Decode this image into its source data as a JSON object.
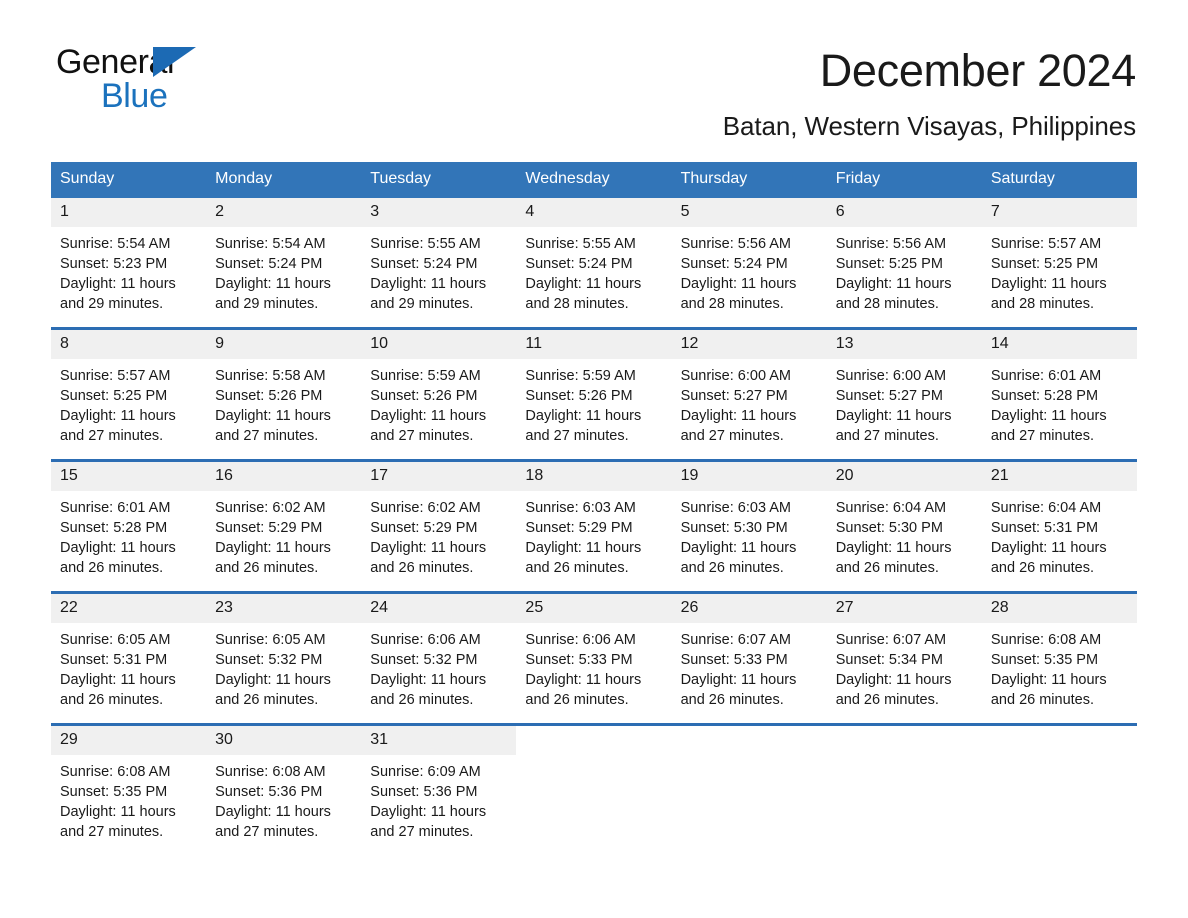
{
  "brand": {
    "name_part1": "General",
    "name_part2": "Blue",
    "logo_icon": "triangle-logo-icon",
    "accent_color": "#1b72bd"
  },
  "header": {
    "month_title": "December 2024",
    "location": "Batan, Western Visayas, Philippines"
  },
  "calendar": {
    "header_bg": "#3275b8",
    "row_divider_color": "#2c6db3",
    "day_number_bg": "#f0f0f0",
    "weekdays": [
      "Sunday",
      "Monday",
      "Tuesday",
      "Wednesday",
      "Thursday",
      "Friday",
      "Saturday"
    ],
    "weeks": [
      [
        {
          "day": "1",
          "sunrise": "Sunrise: 5:54 AM",
          "sunset": "Sunset: 5:23 PM",
          "daylight_line1": "Daylight: 11 hours",
          "daylight_line2": "and 29 minutes."
        },
        {
          "day": "2",
          "sunrise": "Sunrise: 5:54 AM",
          "sunset": "Sunset: 5:24 PM",
          "daylight_line1": "Daylight: 11 hours",
          "daylight_line2": "and 29 minutes."
        },
        {
          "day": "3",
          "sunrise": "Sunrise: 5:55 AM",
          "sunset": "Sunset: 5:24 PM",
          "daylight_line1": "Daylight: 11 hours",
          "daylight_line2": "and 29 minutes."
        },
        {
          "day": "4",
          "sunrise": "Sunrise: 5:55 AM",
          "sunset": "Sunset: 5:24 PM",
          "daylight_line1": "Daylight: 11 hours",
          "daylight_line2": "and 28 minutes."
        },
        {
          "day": "5",
          "sunrise": "Sunrise: 5:56 AM",
          "sunset": "Sunset: 5:24 PM",
          "daylight_line1": "Daylight: 11 hours",
          "daylight_line2": "and 28 minutes."
        },
        {
          "day": "6",
          "sunrise": "Sunrise: 5:56 AM",
          "sunset": "Sunset: 5:25 PM",
          "daylight_line1": "Daylight: 11 hours",
          "daylight_line2": "and 28 minutes."
        },
        {
          "day": "7",
          "sunrise": "Sunrise: 5:57 AM",
          "sunset": "Sunset: 5:25 PM",
          "daylight_line1": "Daylight: 11 hours",
          "daylight_line2": "and 28 minutes."
        }
      ],
      [
        {
          "day": "8",
          "sunrise": "Sunrise: 5:57 AM",
          "sunset": "Sunset: 5:25 PM",
          "daylight_line1": "Daylight: 11 hours",
          "daylight_line2": "and 27 minutes."
        },
        {
          "day": "9",
          "sunrise": "Sunrise: 5:58 AM",
          "sunset": "Sunset: 5:26 PM",
          "daylight_line1": "Daylight: 11 hours",
          "daylight_line2": "and 27 minutes."
        },
        {
          "day": "10",
          "sunrise": "Sunrise: 5:59 AM",
          "sunset": "Sunset: 5:26 PM",
          "daylight_line1": "Daylight: 11 hours",
          "daylight_line2": "and 27 minutes."
        },
        {
          "day": "11",
          "sunrise": "Sunrise: 5:59 AM",
          "sunset": "Sunset: 5:26 PM",
          "daylight_line1": "Daylight: 11 hours",
          "daylight_line2": "and 27 minutes."
        },
        {
          "day": "12",
          "sunrise": "Sunrise: 6:00 AM",
          "sunset": "Sunset: 5:27 PM",
          "daylight_line1": "Daylight: 11 hours",
          "daylight_line2": "and 27 minutes."
        },
        {
          "day": "13",
          "sunrise": "Sunrise: 6:00 AM",
          "sunset": "Sunset: 5:27 PM",
          "daylight_line1": "Daylight: 11 hours",
          "daylight_line2": "and 27 minutes."
        },
        {
          "day": "14",
          "sunrise": "Sunrise: 6:01 AM",
          "sunset": "Sunset: 5:28 PM",
          "daylight_line1": "Daylight: 11 hours",
          "daylight_line2": "and 27 minutes."
        }
      ],
      [
        {
          "day": "15",
          "sunrise": "Sunrise: 6:01 AM",
          "sunset": "Sunset: 5:28 PM",
          "daylight_line1": "Daylight: 11 hours",
          "daylight_line2": "and 26 minutes."
        },
        {
          "day": "16",
          "sunrise": "Sunrise: 6:02 AM",
          "sunset": "Sunset: 5:29 PM",
          "daylight_line1": "Daylight: 11 hours",
          "daylight_line2": "and 26 minutes."
        },
        {
          "day": "17",
          "sunrise": "Sunrise: 6:02 AM",
          "sunset": "Sunset: 5:29 PM",
          "daylight_line1": "Daylight: 11 hours",
          "daylight_line2": "and 26 minutes."
        },
        {
          "day": "18",
          "sunrise": "Sunrise: 6:03 AM",
          "sunset": "Sunset: 5:29 PM",
          "daylight_line1": "Daylight: 11 hours",
          "daylight_line2": "and 26 minutes."
        },
        {
          "day": "19",
          "sunrise": "Sunrise: 6:03 AM",
          "sunset": "Sunset: 5:30 PM",
          "daylight_line1": "Daylight: 11 hours",
          "daylight_line2": "and 26 minutes."
        },
        {
          "day": "20",
          "sunrise": "Sunrise: 6:04 AM",
          "sunset": "Sunset: 5:30 PM",
          "daylight_line1": "Daylight: 11 hours",
          "daylight_line2": "and 26 minutes."
        },
        {
          "day": "21",
          "sunrise": "Sunrise: 6:04 AM",
          "sunset": "Sunset: 5:31 PM",
          "daylight_line1": "Daylight: 11 hours",
          "daylight_line2": "and 26 minutes."
        }
      ],
      [
        {
          "day": "22",
          "sunrise": "Sunrise: 6:05 AM",
          "sunset": "Sunset: 5:31 PM",
          "daylight_line1": "Daylight: 11 hours",
          "daylight_line2": "and 26 minutes."
        },
        {
          "day": "23",
          "sunrise": "Sunrise: 6:05 AM",
          "sunset": "Sunset: 5:32 PM",
          "daylight_line1": "Daylight: 11 hours",
          "daylight_line2": "and 26 minutes."
        },
        {
          "day": "24",
          "sunrise": "Sunrise: 6:06 AM",
          "sunset": "Sunset: 5:32 PM",
          "daylight_line1": "Daylight: 11 hours",
          "daylight_line2": "and 26 minutes."
        },
        {
          "day": "25",
          "sunrise": "Sunrise: 6:06 AM",
          "sunset": "Sunset: 5:33 PM",
          "daylight_line1": "Daylight: 11 hours",
          "daylight_line2": "and 26 minutes."
        },
        {
          "day": "26",
          "sunrise": "Sunrise: 6:07 AM",
          "sunset": "Sunset: 5:33 PM",
          "daylight_line1": "Daylight: 11 hours",
          "daylight_line2": "and 26 minutes."
        },
        {
          "day": "27",
          "sunrise": "Sunrise: 6:07 AM",
          "sunset": "Sunset: 5:34 PM",
          "daylight_line1": "Daylight: 11 hours",
          "daylight_line2": "and 26 minutes."
        },
        {
          "day": "28",
          "sunrise": "Sunrise: 6:08 AM",
          "sunset": "Sunset: 5:35 PM",
          "daylight_line1": "Daylight: 11 hours",
          "daylight_line2": "and 26 minutes."
        }
      ],
      [
        {
          "day": "29",
          "sunrise": "Sunrise: 6:08 AM",
          "sunset": "Sunset: 5:35 PM",
          "daylight_line1": "Daylight: 11 hours",
          "daylight_line2": "and 27 minutes."
        },
        {
          "day": "30",
          "sunrise": "Sunrise: 6:08 AM",
          "sunset": "Sunset: 5:36 PM",
          "daylight_line1": "Daylight: 11 hours",
          "daylight_line2": "and 27 minutes."
        },
        {
          "day": "31",
          "sunrise": "Sunrise: 6:09 AM",
          "sunset": "Sunset: 5:36 PM",
          "daylight_line1": "Daylight: 11 hours",
          "daylight_line2": "and 27 minutes."
        },
        {
          "day": "",
          "sunrise": "",
          "sunset": "",
          "daylight_line1": "",
          "daylight_line2": ""
        },
        {
          "day": "",
          "sunrise": "",
          "sunset": "",
          "daylight_line1": "",
          "daylight_line2": ""
        },
        {
          "day": "",
          "sunrise": "",
          "sunset": "",
          "daylight_line1": "",
          "daylight_line2": ""
        },
        {
          "day": "",
          "sunrise": "",
          "sunset": "",
          "daylight_line1": "",
          "daylight_line2": ""
        }
      ]
    ]
  }
}
